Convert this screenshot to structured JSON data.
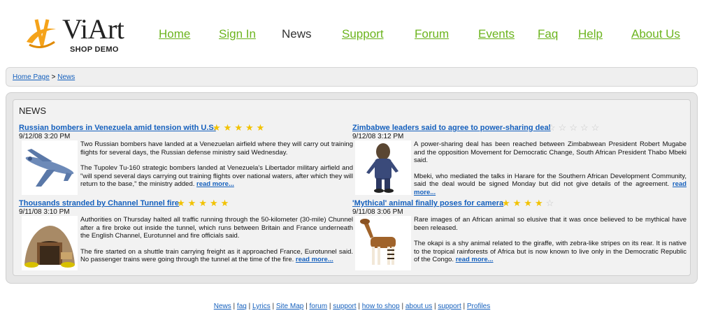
{
  "logo": {
    "name": "ViArt",
    "subtitle": "SHOP DEMO"
  },
  "nav": [
    {
      "label": "Home"
    },
    {
      "label": "Sign In"
    },
    {
      "label": "News",
      "active": true
    },
    {
      "label": "Support"
    },
    {
      "label": "Forum"
    },
    {
      "label": "Events"
    },
    {
      "label": "Faq"
    },
    {
      "label": "Help"
    },
    {
      "label": "About Us"
    }
  ],
  "breadcrumb": {
    "home": "Home Page",
    "separator": ">",
    "current": "News"
  },
  "news": {
    "heading": "NEWS",
    "read_more": "read more...",
    "items": [
      {
        "title": "Russian bombers in Venezuela amid tension with U.S.",
        "date": "9/12/08 3:20 PM",
        "rating": 5,
        "image": "bomber-plane-image",
        "p1": "Two Russian bombers have landed at a Venezuelan airfield where they will carry out training flights for several days, the Russian defense ministry said Wednesday.",
        "p2": "The Tupolev Tu-160 strategic bombers landed at Venezuela's Libertador military airfield and \"will spend several days carrying out training flights over national waters, after which they will return to the base,\" the ministry added."
      },
      {
        "title": "Zimbabwe leaders said to agree to power-sharing deal",
        "date": "9/12/08 3:12 PM",
        "rating": 0,
        "image": "leader-caricature-image",
        "p1": "A power-sharing deal has been reached between Zimbabwean President Robert Mugabe and the opposition Movement for Democratic Change, South African President Thabo Mbeki said.",
        "p2": "Mbeki, who mediated the talks in Harare for the Southern African Development Community, said the deal would be signed Monday but did not give details of the agreement."
      },
      {
        "title": "Thousands stranded by Channel Tunnel fire",
        "date": "9/11/08 3:10 PM",
        "rating": 5,
        "image": "tunnel-entrance-image",
        "p1": "Authorities on Thursday halted all traffic running through the 50-kilometer (30-mile) Chunnel after a fire broke out inside the tunnel, which runs between Britain and France underneath the English Channel, Eurotunnel and fire officials said.",
        "p2": "The fire started on a shuttle train carrying freight as it approached France, Eurotunnel said. No passenger trains were going through the tunnel at the time of the fire."
      },
      {
        "title": "'Mythical' animal finally poses for camera",
        "date": "9/11/08 3:06 PM",
        "rating": 4,
        "image": "okapi-image",
        "p1": "Rare images of an African animal so elusive that it was once believed to be mythical have been released.",
        "p2": "The okapi is a shy animal related to the giraffe, with zebra-like stripes on its rear. It is native to the tropical rainforests of Africa but is now known to live only in the Democratic Republic of the Congo."
      }
    ]
  },
  "footer": {
    "links": [
      "News",
      "faq",
      "Lyrics",
      "Site Map",
      "forum",
      "support",
      "how to shop",
      "about us",
      "support",
      "Profiles"
    ],
    "separator": "|"
  },
  "colors": {
    "nav_link": "#6cb41e",
    "link": "#1560bd",
    "star_on": "#f2c200",
    "star_off": "#c8c8c8"
  }
}
